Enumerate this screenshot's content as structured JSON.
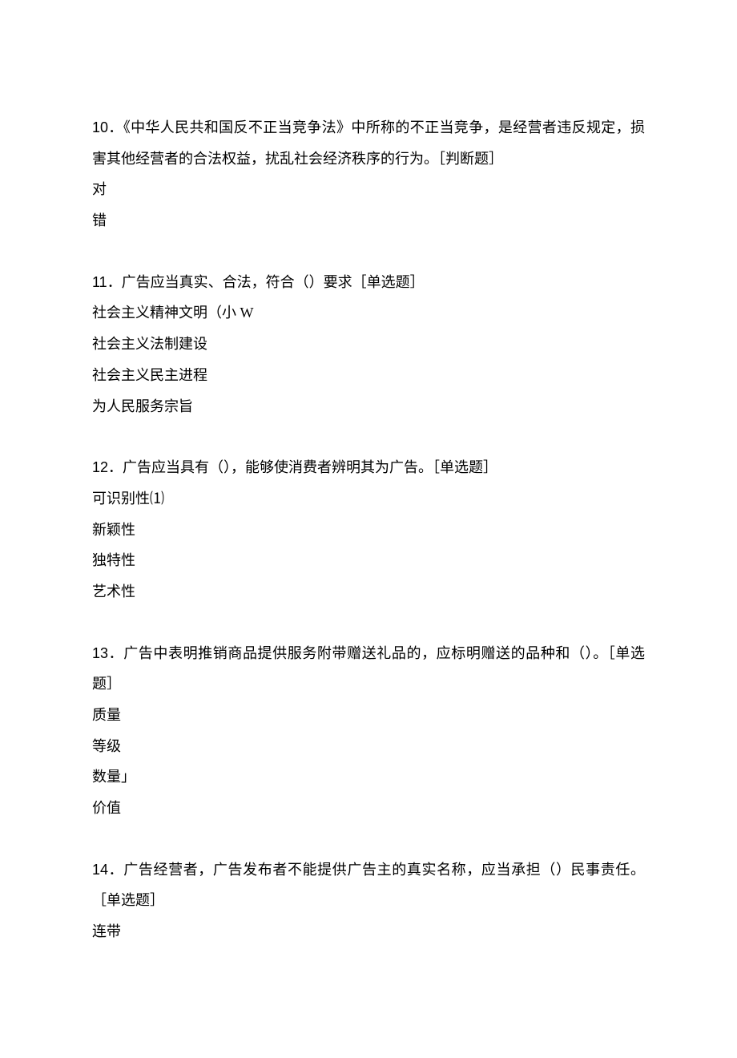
{
  "questions": [
    {
      "number": "10",
      "text": "．《中华人民共和国反不正当竞争法》中所称的不正当竞争，是经营者违反规定，损害其他经营者的合法权益，扰乱社会经济秩序的行为。［判断题］",
      "options": [
        "对",
        "错"
      ]
    },
    {
      "number": "11",
      "text": "．广告应当真实、合法，符合（）要求［单选题］",
      "options": [
        "社会主义精神文明（小 W",
        "社会主义法制建设",
        "社会主义民主进程",
        "为人民服务宗旨"
      ]
    },
    {
      "number": "12",
      "text": "．广告应当具有（），能够使消费者辨明其为广告。［单选题］",
      "options": [
        "可识别性⑴",
        "新颖性",
        "独特性",
        "艺术性"
      ]
    },
    {
      "number": "13",
      "text": "．广告中表明推销商品提供服务附带赠送礼品的，应标明赠送的品种和（）。［单选题］",
      "options": [
        "质量",
        "等级",
        "数量」",
        "价值"
      ]
    },
    {
      "number": "14",
      "text": "．广告经营者，广告发布者不能提供广告主的真实名称，应当承担（）民事责任。［单选题］",
      "options": [
        "连带"
      ]
    }
  ]
}
